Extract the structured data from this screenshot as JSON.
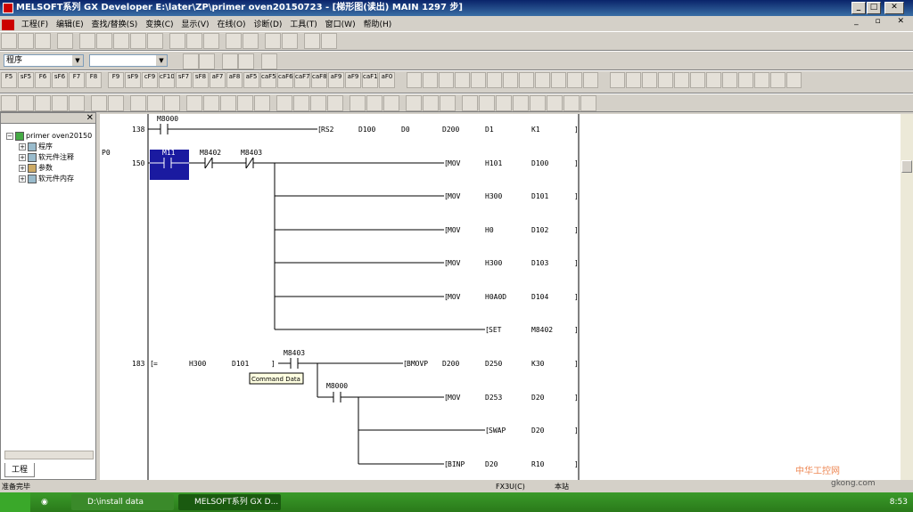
{
  "window": {
    "title": "MELSOFT系列 GX Developer E:\\later\\ZP\\primer oven20150723 - [梯形图(读出)     MAIN     1297 步]"
  },
  "menu": [
    "工程(F)",
    "编辑(E)",
    "查找/替换(S)",
    "变换(C)",
    "显示(V)",
    "在线(O)",
    "诊断(D)",
    "工具(T)",
    "窗口(W)",
    "帮助(H)"
  ],
  "toolbar": {
    "program_select": "程序"
  },
  "fkeys": [
    "F5",
    "sF5",
    "F6",
    "sF6",
    "F7",
    "F8",
    "",
    "F9",
    "sF9",
    "cF9",
    "cF10",
    "sF7",
    "sF8",
    "aF7",
    "aF8",
    "aF5",
    "caF5",
    "caF6",
    "caF7",
    "caF8",
    "aF9",
    "aF9",
    "caF10",
    "aF0",
    "F10",
    "aF9"
  ],
  "project_tree": {
    "root": "primer oven20150",
    "items": [
      "程序",
      "软元件注释",
      "参数",
      "软元件内存"
    ],
    "tab": "工程"
  },
  "ladder": {
    "p_label": "P0",
    "step_138": "138",
    "step_150": "150",
    "step_183": "183",
    "c_m8000": "M8000",
    "c_m11": "M11",
    "c_m8402": "M8402",
    "c_m8403": "M8403",
    "c_m8403b": "M8403",
    "c_m8000b": "M8000",
    "rs2": [
      "RS2",
      "D100",
      "D0",
      "D200",
      "D1",
      "K1"
    ],
    "mov1": [
      "MOV",
      "H101",
      "D100"
    ],
    "mov2": [
      "MOV",
      "H300",
      "D101"
    ],
    "mov3": [
      "MOV",
      "H0",
      "D102"
    ],
    "mov4": [
      "MOV",
      "H300",
      "D103"
    ],
    "mov5": [
      "MOV",
      "H0A0D",
      "D104"
    ],
    "set": [
      "SET",
      "M8402"
    ],
    "cmp": [
      "=",
      "H300",
      "D101"
    ],
    "bmov": [
      "BMOVP",
      "D200",
      "D250",
      "K30"
    ],
    "mov6": [
      "MOV",
      "D253",
      "D20"
    ],
    "swap": [
      "SWAP",
      "D20"
    ],
    "binp": [
      "BINP",
      "D20",
      "R10"
    ],
    "tooltip": "Command Data"
  },
  "status": {
    "left": "准备完毕",
    "cpu": "FX3U(C)",
    "station": "本站"
  },
  "taskbar": {
    "task1": "D:\\install data",
    "task2": "MELSOFT系列 GX D...",
    "clock": "8:53"
  },
  "watermark": {
    "text1": "中华工控网",
    "text2": "gkong.com"
  }
}
